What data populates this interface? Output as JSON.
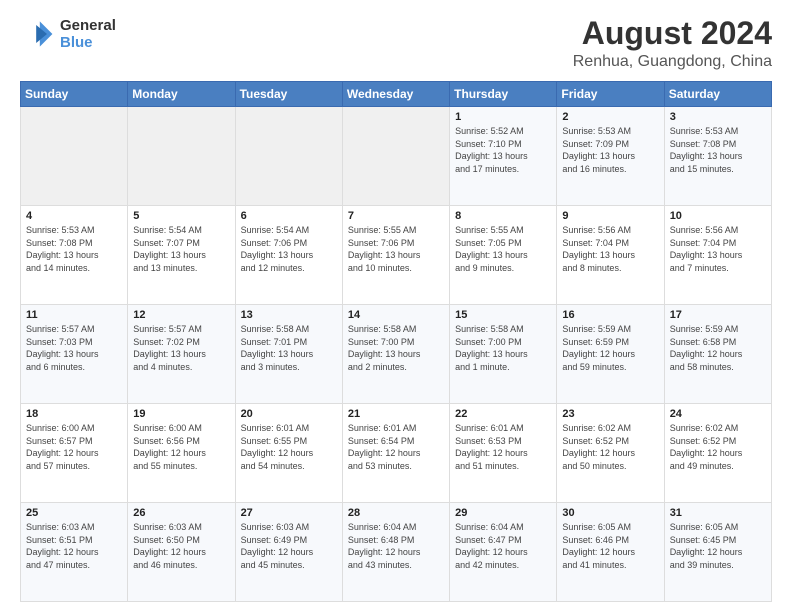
{
  "logo": {
    "line1": "General",
    "line2": "Blue"
  },
  "title": "August 2024",
  "subtitle": "Renhua, Guangdong, China",
  "days_of_week": [
    "Sunday",
    "Monday",
    "Tuesday",
    "Wednesday",
    "Thursday",
    "Friday",
    "Saturday"
  ],
  "weeks": [
    [
      {
        "day": "",
        "info": ""
      },
      {
        "day": "",
        "info": ""
      },
      {
        "day": "",
        "info": ""
      },
      {
        "day": "",
        "info": ""
      },
      {
        "day": "1",
        "info": "Sunrise: 5:52 AM\nSunset: 7:10 PM\nDaylight: 13 hours\nand 17 minutes."
      },
      {
        "day": "2",
        "info": "Sunrise: 5:53 AM\nSunset: 7:09 PM\nDaylight: 13 hours\nand 16 minutes."
      },
      {
        "day": "3",
        "info": "Sunrise: 5:53 AM\nSunset: 7:08 PM\nDaylight: 13 hours\nand 15 minutes."
      }
    ],
    [
      {
        "day": "4",
        "info": "Sunrise: 5:53 AM\nSunset: 7:08 PM\nDaylight: 13 hours\nand 14 minutes."
      },
      {
        "day": "5",
        "info": "Sunrise: 5:54 AM\nSunset: 7:07 PM\nDaylight: 13 hours\nand 13 minutes."
      },
      {
        "day": "6",
        "info": "Sunrise: 5:54 AM\nSunset: 7:06 PM\nDaylight: 13 hours\nand 12 minutes."
      },
      {
        "day": "7",
        "info": "Sunrise: 5:55 AM\nSunset: 7:06 PM\nDaylight: 13 hours\nand 10 minutes."
      },
      {
        "day": "8",
        "info": "Sunrise: 5:55 AM\nSunset: 7:05 PM\nDaylight: 13 hours\nand 9 minutes."
      },
      {
        "day": "9",
        "info": "Sunrise: 5:56 AM\nSunset: 7:04 PM\nDaylight: 13 hours\nand 8 minutes."
      },
      {
        "day": "10",
        "info": "Sunrise: 5:56 AM\nSunset: 7:04 PM\nDaylight: 13 hours\nand 7 minutes."
      }
    ],
    [
      {
        "day": "11",
        "info": "Sunrise: 5:57 AM\nSunset: 7:03 PM\nDaylight: 13 hours\nand 6 minutes."
      },
      {
        "day": "12",
        "info": "Sunrise: 5:57 AM\nSunset: 7:02 PM\nDaylight: 13 hours\nand 4 minutes."
      },
      {
        "day": "13",
        "info": "Sunrise: 5:58 AM\nSunset: 7:01 PM\nDaylight: 13 hours\nand 3 minutes."
      },
      {
        "day": "14",
        "info": "Sunrise: 5:58 AM\nSunset: 7:00 PM\nDaylight: 13 hours\nand 2 minutes."
      },
      {
        "day": "15",
        "info": "Sunrise: 5:58 AM\nSunset: 7:00 PM\nDaylight: 13 hours\nand 1 minute."
      },
      {
        "day": "16",
        "info": "Sunrise: 5:59 AM\nSunset: 6:59 PM\nDaylight: 12 hours\nand 59 minutes."
      },
      {
        "day": "17",
        "info": "Sunrise: 5:59 AM\nSunset: 6:58 PM\nDaylight: 12 hours\nand 58 minutes."
      }
    ],
    [
      {
        "day": "18",
        "info": "Sunrise: 6:00 AM\nSunset: 6:57 PM\nDaylight: 12 hours\nand 57 minutes."
      },
      {
        "day": "19",
        "info": "Sunrise: 6:00 AM\nSunset: 6:56 PM\nDaylight: 12 hours\nand 55 minutes."
      },
      {
        "day": "20",
        "info": "Sunrise: 6:01 AM\nSunset: 6:55 PM\nDaylight: 12 hours\nand 54 minutes."
      },
      {
        "day": "21",
        "info": "Sunrise: 6:01 AM\nSunset: 6:54 PM\nDaylight: 12 hours\nand 53 minutes."
      },
      {
        "day": "22",
        "info": "Sunrise: 6:01 AM\nSunset: 6:53 PM\nDaylight: 12 hours\nand 51 minutes."
      },
      {
        "day": "23",
        "info": "Sunrise: 6:02 AM\nSunset: 6:52 PM\nDaylight: 12 hours\nand 50 minutes."
      },
      {
        "day": "24",
        "info": "Sunrise: 6:02 AM\nSunset: 6:52 PM\nDaylight: 12 hours\nand 49 minutes."
      }
    ],
    [
      {
        "day": "25",
        "info": "Sunrise: 6:03 AM\nSunset: 6:51 PM\nDaylight: 12 hours\nand 47 minutes."
      },
      {
        "day": "26",
        "info": "Sunrise: 6:03 AM\nSunset: 6:50 PM\nDaylight: 12 hours\nand 46 minutes."
      },
      {
        "day": "27",
        "info": "Sunrise: 6:03 AM\nSunset: 6:49 PM\nDaylight: 12 hours\nand 45 minutes."
      },
      {
        "day": "28",
        "info": "Sunrise: 6:04 AM\nSunset: 6:48 PM\nDaylight: 12 hours\nand 43 minutes."
      },
      {
        "day": "29",
        "info": "Sunrise: 6:04 AM\nSunset: 6:47 PM\nDaylight: 12 hours\nand 42 minutes."
      },
      {
        "day": "30",
        "info": "Sunrise: 6:05 AM\nSunset: 6:46 PM\nDaylight: 12 hours\nand 41 minutes."
      },
      {
        "day": "31",
        "info": "Sunrise: 6:05 AM\nSunset: 6:45 PM\nDaylight: 12 hours\nand 39 minutes."
      }
    ]
  ]
}
